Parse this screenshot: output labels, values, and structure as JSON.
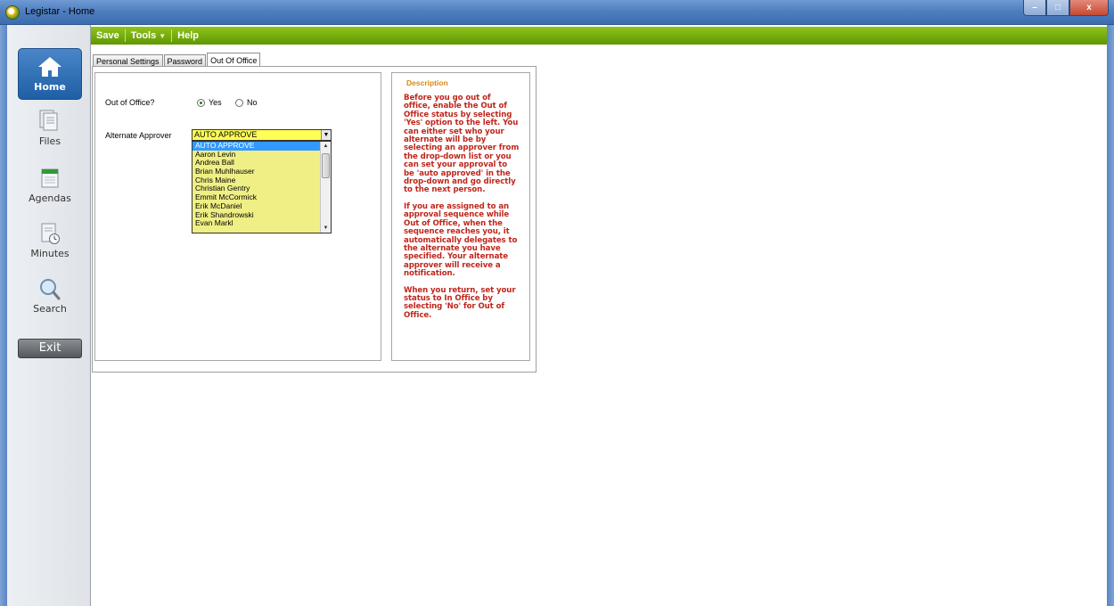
{
  "window": {
    "title": "Legistar - Home",
    "min": "–",
    "max": "□",
    "close": "x"
  },
  "menu": [
    {
      "label": "Save"
    },
    {
      "label": "Tools",
      "has_arrow": true
    },
    {
      "label": "Help"
    }
  ],
  "sidebar": {
    "items": [
      {
        "label": "Home",
        "icon": "home-icon",
        "active": true
      },
      {
        "label": "Files",
        "icon": "files-icon"
      },
      {
        "label": "Agendas",
        "icon": "agendas-icon"
      },
      {
        "label": "Minutes",
        "icon": "minutes-icon"
      },
      {
        "label": "Search",
        "icon": "search-icon"
      }
    ],
    "exit_label": "Exit"
  },
  "tabs": [
    {
      "label": "Personal Settings"
    },
    {
      "label": "Password"
    },
    {
      "label": "Out Of Office",
      "active": true
    }
  ],
  "form": {
    "out_of_office_label": "Out of Office?",
    "yes_label": "Yes",
    "no_label": "No",
    "selected": "Yes",
    "alternate_label": "Alternate Approver",
    "alternate_value": "AUTO APPROVE",
    "options": [
      "AUTO APPROVE",
      "Aaron Levin",
      "Andrea Ball",
      "Brian Muhlhauser",
      "Chris Maine",
      "Christian Gentry",
      "Emmit McCormick",
      "Erik McDaniel",
      "Erik Shandrowski",
      "Evan Markl"
    ]
  },
  "description": {
    "title": "Description",
    "paragraphs": [
      "Before you go out of office, enable the Out of Office status by selecting 'Yes' option to the left. You can either set who your alternate will be by selecting an approver from the drop-down list or you can set your approval to be 'auto approved' in the drop-down and go directly to the next person.",
      "If you are assigned to an approval sequence while Out of Office, when the sequence reaches you, it automatically delegates to the alternate you have specified. Your alternate approver will receive a notification.",
      "When you return, set your status to In Office by selecting 'No' for Out of Office."
    ]
  },
  "colors": {
    "menu_green": "#6aa30a",
    "active_nav_blue": "#2d6db3",
    "combo_yellow": "#ffff55",
    "description_red": "#c0261c",
    "description_title_orange": "#d98a12"
  }
}
